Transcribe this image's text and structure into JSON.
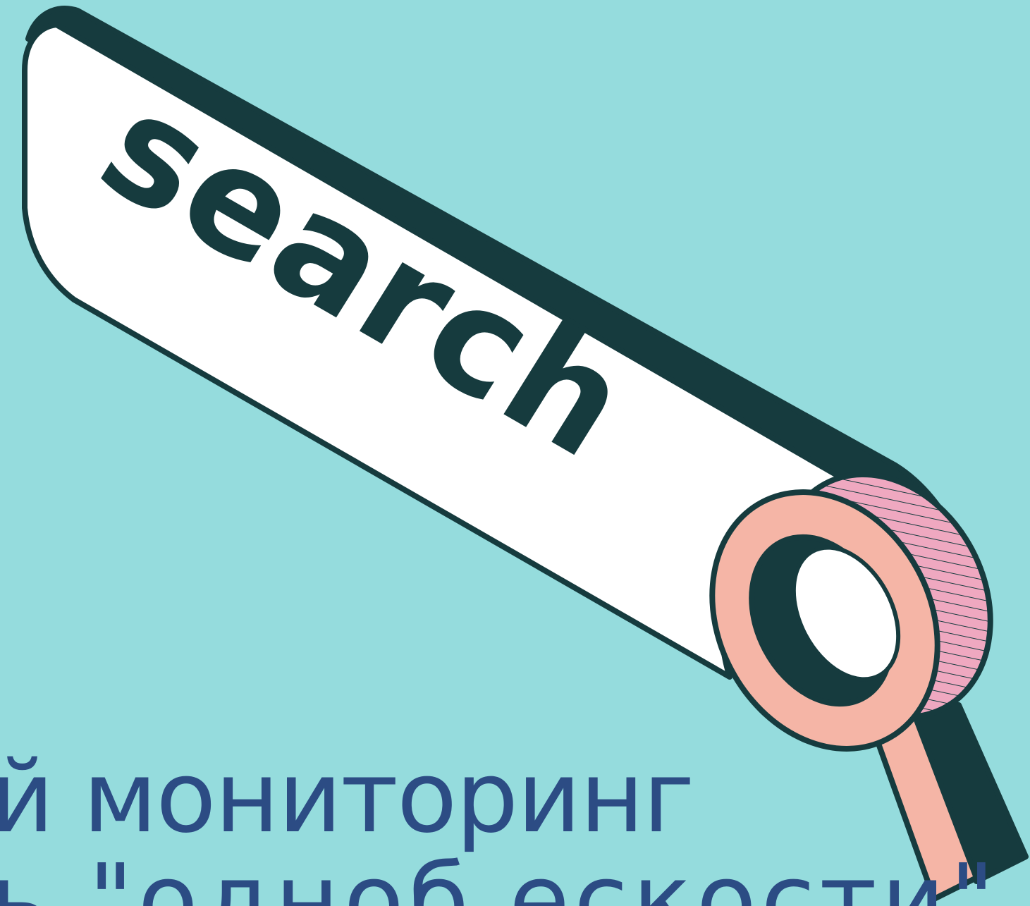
{
  "illustration": {
    "search_bar_text": "search",
    "icon": "magnifying-glass-icon"
  },
  "headline": {
    "line1": "й мониторинг",
    "line2": "ь \"одноб ескости\""
  },
  "colors": {
    "background": "#95dcdd",
    "outline": "#163b3e",
    "bar_fill": "#ffffff",
    "lens_ring": "#f5b5a6",
    "lens_side": "#efa8c0",
    "headline_text": "#2c4c84"
  }
}
